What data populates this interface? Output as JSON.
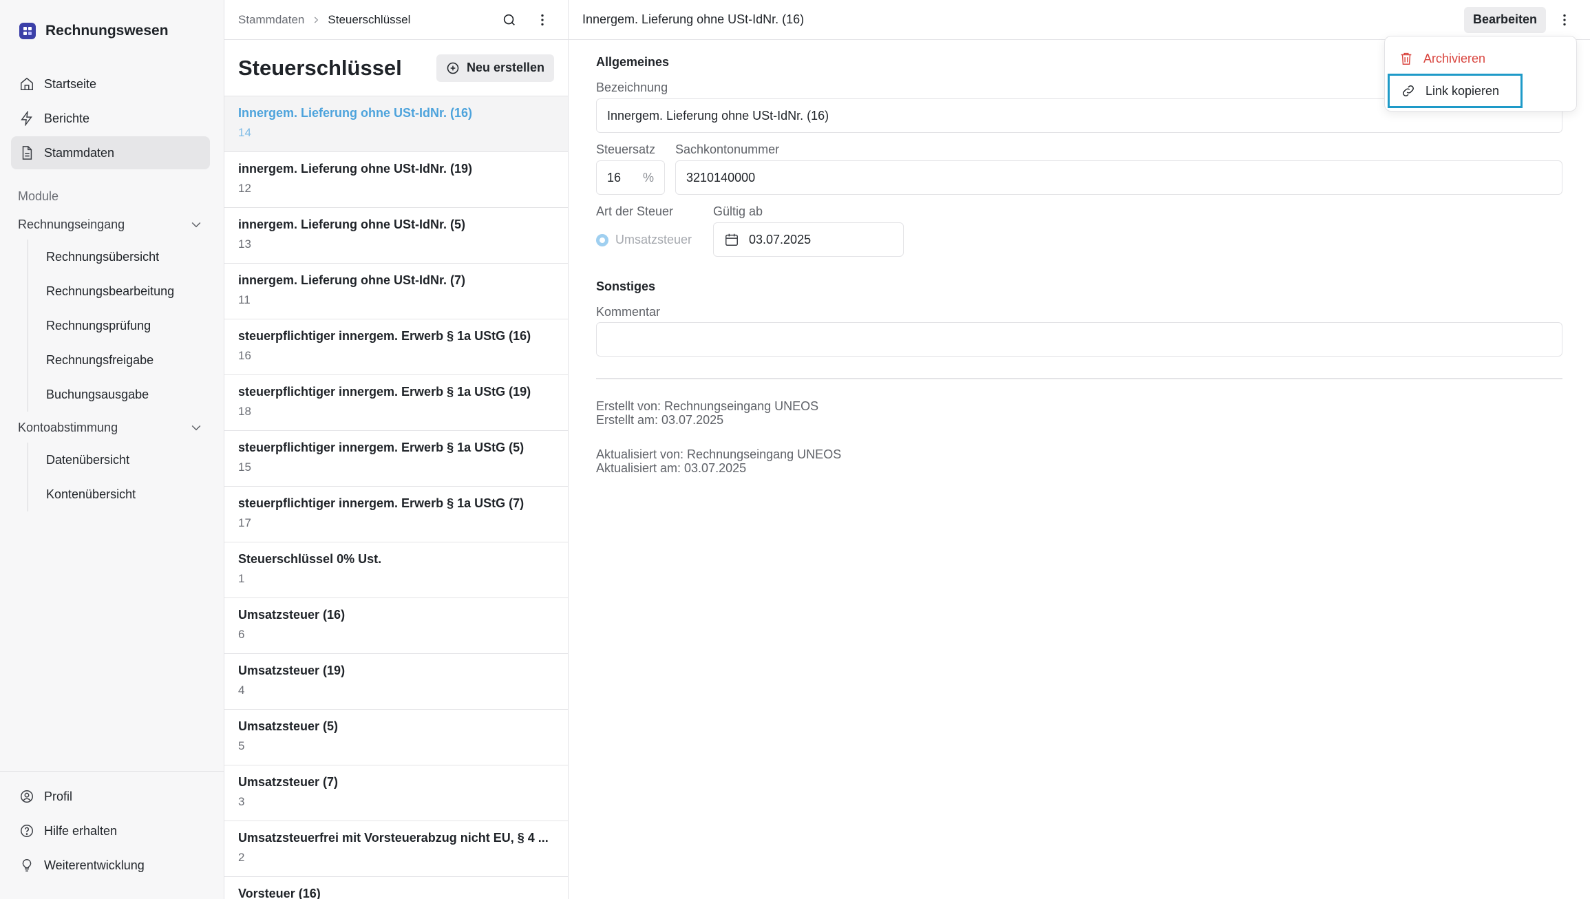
{
  "app": {
    "title": "Rechnungswesen"
  },
  "nav": {
    "items": [
      {
        "label": "Startseite",
        "icon": "home-icon"
      },
      {
        "label": "Berichte",
        "icon": "lightning-icon"
      },
      {
        "label": "Stammdaten",
        "icon": "document-icon",
        "active": true
      }
    ],
    "section_label": "Module",
    "groups": [
      {
        "label": "Rechnungseingang",
        "items": [
          "Rechnungsübersicht",
          "Rechnungsbearbeitung",
          "Rechnungsprüfung",
          "Rechnungsfreigabe",
          "Buchungsausgabe"
        ]
      },
      {
        "label": "Kontoabstimmung",
        "items": [
          "Datenübersicht",
          "Kontenübersicht"
        ]
      }
    ],
    "bottom": [
      {
        "label": "Profil",
        "icon": "user-circle-icon"
      },
      {
        "label": "Hilfe erhalten",
        "icon": "help-circle-icon"
      },
      {
        "label": "Weiterentwicklung",
        "icon": "lightbulb-icon"
      }
    ]
  },
  "list": {
    "breadcrumb": [
      "Stammdaten",
      "Steuerschlüssel"
    ],
    "title": "Steuerschlüssel",
    "new_label": "Neu erstellen",
    "rows": [
      {
        "title": "Innergem. Lieferung ohne USt-IdNr. (16)",
        "sub": "14",
        "selected": true
      },
      {
        "title": "innergem. Lieferung ohne USt-IdNr. (19)",
        "sub": "12"
      },
      {
        "title": "innergem. Lieferung ohne USt-IdNr. (5)",
        "sub": "13"
      },
      {
        "title": "innergem. Lieferung ohne USt-IdNr. (7)",
        "sub": "11"
      },
      {
        "title": "steuerpflichtiger innergem. Erwerb § 1a UStG (16)",
        "sub": "16"
      },
      {
        "title": "steuerpflichtiger innergem. Erwerb § 1a UStG (19)",
        "sub": "18"
      },
      {
        "title": "steuerpflichtiger innergem. Erwerb § 1a UStG (5)",
        "sub": "15"
      },
      {
        "title": "steuerpflichtiger innergem. Erwerb § 1a UStG (7)",
        "sub": "17"
      },
      {
        "title": "Steuerschlüssel 0% Ust.",
        "sub": "1"
      },
      {
        "title": "Umsatzsteuer (16)",
        "sub": "6"
      },
      {
        "title": "Umsatzsteuer (19)",
        "sub": "4"
      },
      {
        "title": "Umsatzsteuer (5)",
        "sub": "5"
      },
      {
        "title": "Umsatzsteuer (7)",
        "sub": "3"
      },
      {
        "title": "Umsatzsteuerfrei mit Vorsteuerabzug nicht EU, § 4 ...",
        "sub": "2"
      },
      {
        "title": "Vorsteuer (16)",
        "sub": ""
      }
    ]
  },
  "detail": {
    "title": "Innergem. Lieferung ohne USt-IdNr. (16)",
    "edit_label": "Bearbeiten",
    "section_general": "Allgemeines",
    "bezeichnung_label": "Bezeichnung",
    "bezeichnung_value": "Innergem. Lieferung ohne USt-IdNr. (16)",
    "steuersatz_label": "Steuersatz",
    "steuersatz_value": "16",
    "steuersatz_unit": "%",
    "sachkonto_label": "Sachkontonummer",
    "sachkonto_value": "3210140000",
    "art_label": "Art der Steuer",
    "art_value": "Umsatzsteuer",
    "gueltig_label": "Gültig ab",
    "gueltig_value": "03.07.2025",
    "section_other": "Sonstiges",
    "kommentar_label": "Kommentar",
    "kommentar_value": "",
    "created_by": "Erstellt von: Rechnungseingang UNEOS",
    "created_at": "Erstellt am: 03.07.2025",
    "updated_by": "Aktualisiert von: Rechnungseingang UNEOS",
    "updated_at": "Aktualisiert am: 03.07.2025"
  },
  "menu": {
    "archive_label": "Archivieren",
    "copy_link_label": "Link kopieren"
  },
  "colors": {
    "accent_link": "#4da3dc",
    "danger": "#d9453f",
    "focus_ring": "#1e9ac8",
    "brand": "#3b3fa8"
  }
}
